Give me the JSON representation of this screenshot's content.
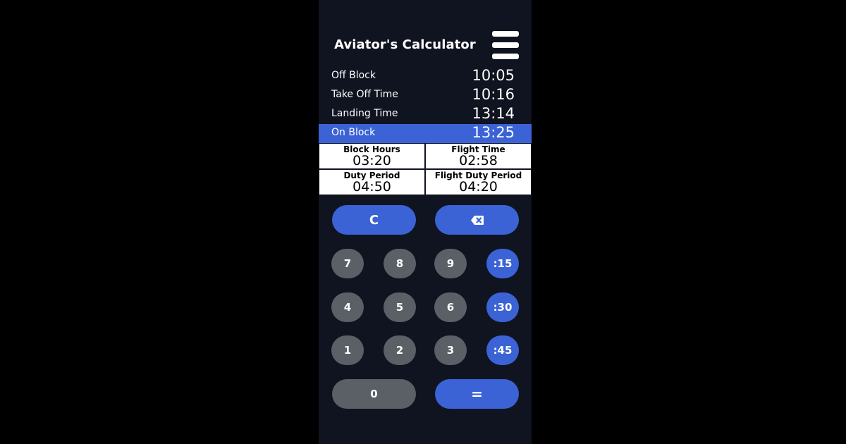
{
  "app": {
    "title": "Aviator's Calculator",
    "menu_icon": "hamburger-menu-icon"
  },
  "times": [
    {
      "label": "Off Block",
      "value": "10:05",
      "active": false
    },
    {
      "label": "Take Off Time",
      "value": "10:16",
      "active": false
    },
    {
      "label": "Landing Time",
      "value": "13:14",
      "active": false
    },
    {
      "label": "On Block",
      "value": "13:25",
      "active": true
    }
  ],
  "results": [
    {
      "label": "Block Hours",
      "value": "03:20"
    },
    {
      "label": "Flight Time",
      "value": "02:58"
    },
    {
      "label": "Duty Period",
      "value": "04:50"
    },
    {
      "label": "Flight Duty Period",
      "value": "04:20"
    }
  ],
  "keys": {
    "clear": "C",
    "backspace_icon": "backspace-icon",
    "k7": "7",
    "k8": "8",
    "k9": "9",
    "m15": ":15",
    "k4": "4",
    "k5": "5",
    "k6": "6",
    "m30": ":30",
    "k1": "1",
    "k2": "2",
    "k3": "3",
    "m45": ":45",
    "k0": "0",
    "equals": "="
  },
  "colors": {
    "accent": "#3b63d6",
    "key_gray": "#5b5f66",
    "background": "#0f1420"
  }
}
